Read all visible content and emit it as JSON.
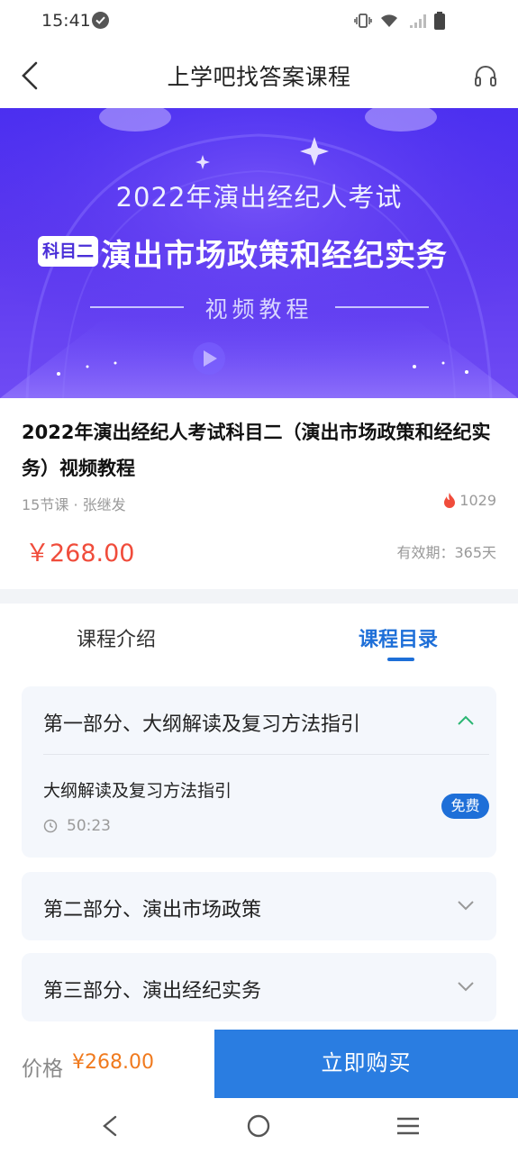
{
  "status_bar": {
    "time": "15:41"
  },
  "nav": {
    "title": "上学吧找答案课程"
  },
  "banner": {
    "line1": "2022年演出经纪人考试",
    "tag": "科目二",
    "main": "演出市场政策和经纪实务",
    "line3": "视频教程"
  },
  "course": {
    "title": "2022年演出经纪人考试科目二（演出市场政策和经纪实务）视频教程",
    "meta": "15节课 · 张继发",
    "views": "1029",
    "price": "￥268.00",
    "validity": "有效期：365天"
  },
  "tabs": {
    "intro": "课程介绍",
    "catalog": "课程目录"
  },
  "sections": [
    {
      "title": "第一部分、大纲解读及复习方法指引",
      "expanded": true,
      "lessons": [
        {
          "title": "大纲解读及复习方法指引",
          "duration": "50:23",
          "badge": "免费"
        }
      ]
    },
    {
      "title": "第二部分、演出市场政策",
      "expanded": false
    },
    {
      "title": "第三部分、演出经纪实务",
      "expanded": false
    }
  ],
  "bottom": {
    "price_label": "价格",
    "price": "¥268.00",
    "buy_label": "立即购买"
  },
  "colors": {
    "accent_blue": "#1e6fd8",
    "buy_button": "#2a7de1",
    "price_red": "#f04c3b",
    "price_orange": "#f07a1e",
    "banner_purple": "#5b37ee"
  }
}
